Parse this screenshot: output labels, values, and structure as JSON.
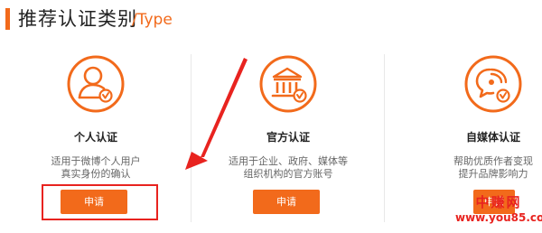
{
  "header": {
    "title": "推荐认证类别",
    "subtitle": "/Type"
  },
  "cards": [
    {
      "title": "个人认证",
      "desc_line1": "适用于微博个人用户",
      "desc_line2": "真实身份的确认",
      "button_label": "申请",
      "icon": "person-verified-icon"
    },
    {
      "title": "官方认证",
      "desc_line1": "适用于企业、政府、媒体等",
      "desc_line2": "组织机构的官方账号",
      "button_label": "申请",
      "icon": "institution-building-icon"
    },
    {
      "title": "自媒体认证",
      "desc_line1": "帮助优质作者变现",
      "desc_line2": "提升品牌影响力",
      "button_label": "申请",
      "icon": "self-media-chat-icon"
    }
  ],
  "watermark": {
    "line1": "中赚网",
    "line2": "www.you85.com"
  },
  "colors": {
    "accent": "#f26a1b",
    "annotation": "#e8231f",
    "text": "#222222",
    "muted": "#666666",
    "divider": "#e8e8e8"
  }
}
